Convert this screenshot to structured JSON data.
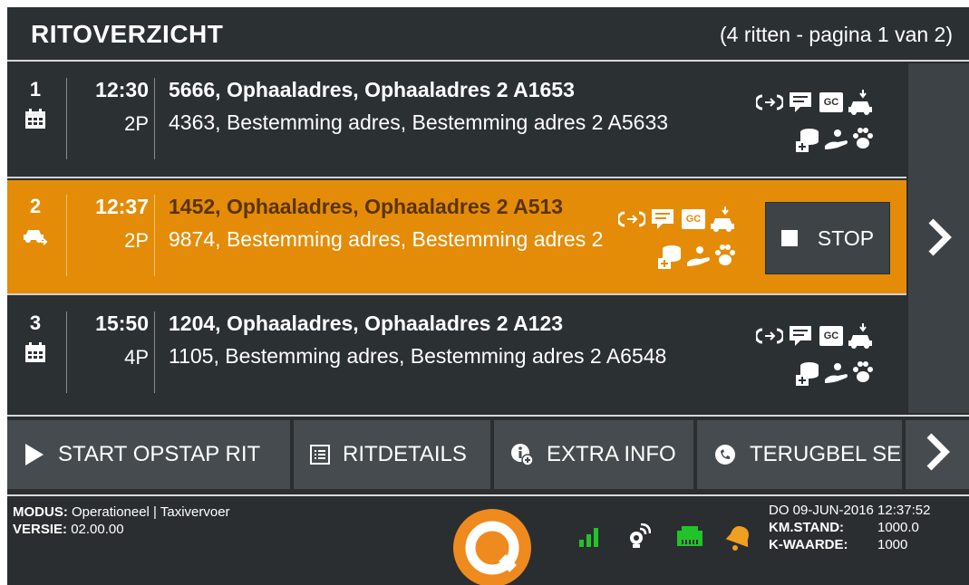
{
  "header": {
    "title": "RITOVERZICHT",
    "info": "(4 ritten - pagina 1 van 2)"
  },
  "rides": [
    {
      "number": "1",
      "status_icon": "calendar-icon",
      "time": "12:30",
      "persons": "2P",
      "pickup": "5666, Ophaaladres, Ophaaladres 2 A1653",
      "destination": "4363, Bestemming adres, Bestemming adres 2 A5633",
      "selected": false
    },
    {
      "number": "2",
      "status_icon": "car-arrow-icon",
      "time": "12:37",
      "persons": "2P",
      "pickup": "1452, Ophaaladres, Ophaaladres 2 A513",
      "destination": "9874, Bestemming adres, Bestemming adres 2",
      "selected": true
    },
    {
      "number": "3",
      "status_icon": "calendar-icon",
      "time": "15:50",
      "persons": "4P",
      "pickup": "1204, Ophaaladres, Ophaaladres 2 A123",
      "destination": "1105, Bestemming adres, Bestemming adres 2 A6548",
      "selected": false
    }
  ],
  "ride_icons": {
    "phone": "call-forward-icon",
    "message": "message-icon",
    "gc": "GC",
    "car": "car-download-icon",
    "money": "money-add-icon",
    "hand": "hand-icon",
    "pet": "paw-icon"
  },
  "stop_button": {
    "label": "STOP"
  },
  "actions": [
    {
      "label": "START OPSTAP RIT",
      "icon": "play-icon"
    },
    {
      "label": "RITDETAILS",
      "icon": "list-icon"
    },
    {
      "label": "EXTRA INFO",
      "icon": "info-add-icon"
    },
    {
      "label": "TERUGBEL SE",
      "icon": "callback-icon"
    }
  ],
  "status": {
    "modus_label": "MODUS:",
    "modus_value": "Operationeel | Taxivervoer",
    "versie_label": "VERSIE:",
    "versie_value": "02.00.00",
    "datetime": "DO 09-JUN-2016 12:37:52",
    "km_label": "KM.STAND:",
    "km_value": "1000.0",
    "k_label": "K-WAARDE:",
    "k_value": "1000"
  },
  "colors": {
    "accent": "#e48c08",
    "background": "#2b3033",
    "signal_green": "#22c32a",
    "bell_orange": "#f0a020"
  }
}
